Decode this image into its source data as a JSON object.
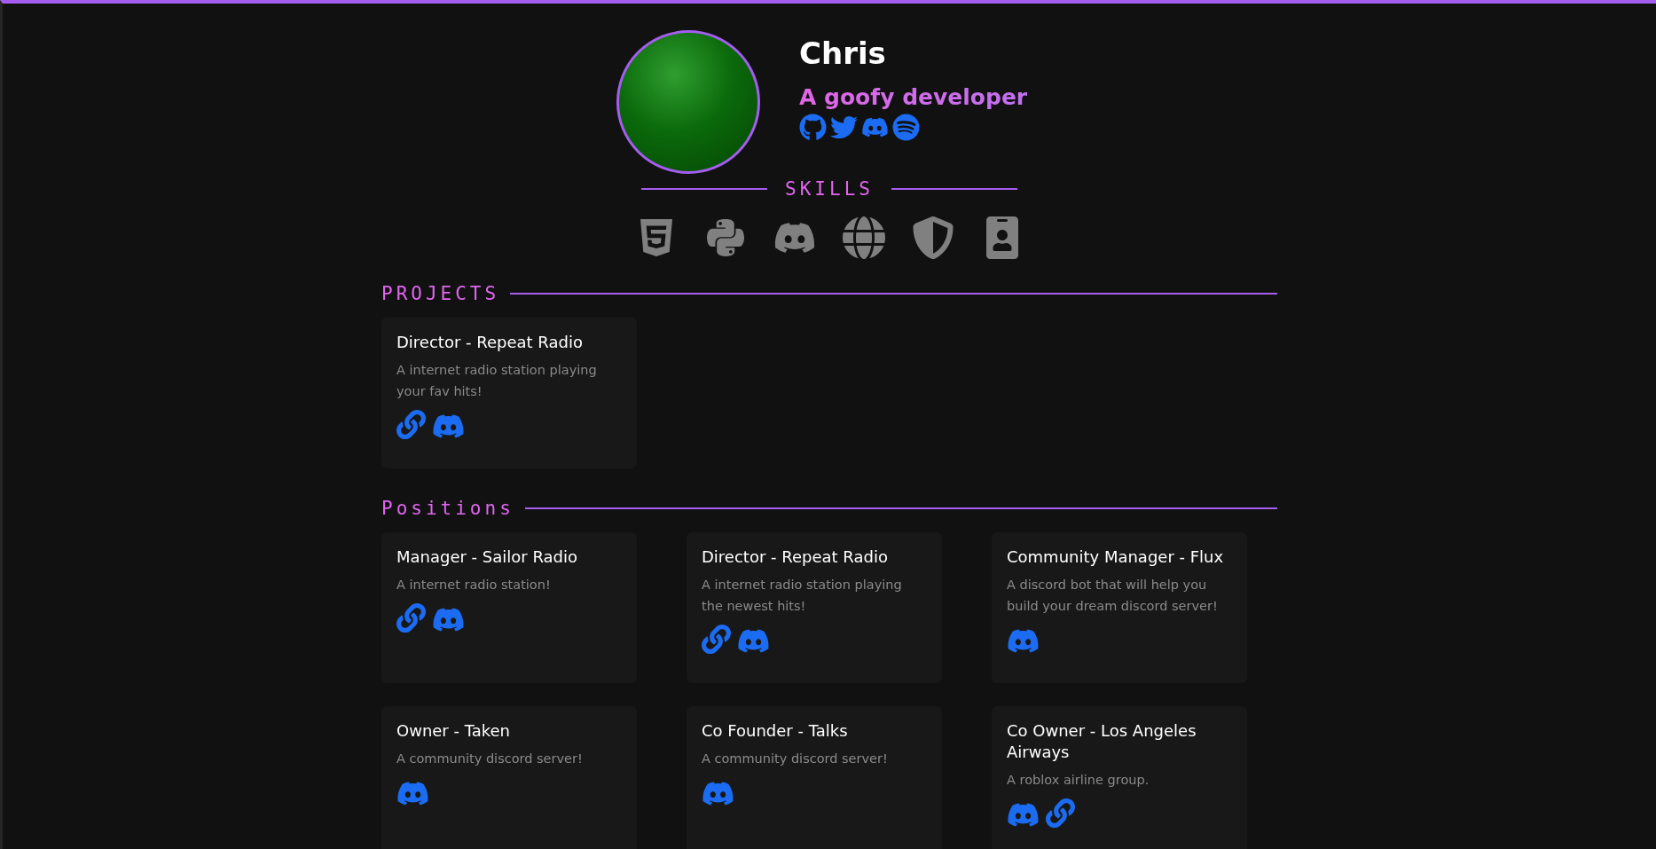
{
  "profile": {
    "name": "Chris",
    "tagline": "A goofy developer",
    "socials": [
      {
        "kind": "github"
      },
      {
        "kind": "twitter"
      },
      {
        "kind": "discord"
      },
      {
        "kind": "spotify"
      }
    ]
  },
  "skills": {
    "title": "SKILLS",
    "items": [
      {
        "kind": "html"
      },
      {
        "kind": "python"
      },
      {
        "kind": "discord"
      },
      {
        "kind": "web"
      },
      {
        "kind": "security"
      },
      {
        "kind": "badge"
      }
    ]
  },
  "projects": {
    "title": "PROJECTS",
    "cards": [
      {
        "title": "Director - Repeat Radio",
        "description": "A internet radio station playing your fav hits!",
        "links": [
          {
            "kind": "website"
          },
          {
            "kind": "discord"
          }
        ]
      }
    ]
  },
  "positions": {
    "title": "Positions",
    "cards": [
      {
        "title": "Manager - Sailor Radio",
        "description": "A internet radio station!",
        "links": [
          {
            "kind": "website"
          },
          {
            "kind": "discord"
          }
        ]
      },
      {
        "title": "Director - Repeat Radio",
        "description": "A internet radio station playing the newest hits!",
        "links": [
          {
            "kind": "website"
          },
          {
            "kind": "discord"
          }
        ]
      },
      {
        "title": "Community Manager - Flux",
        "description": "A discord bot that will help you build your dream discord server!",
        "links": [
          {
            "kind": "discord"
          }
        ]
      },
      {
        "title": "Owner - Taken",
        "description": "A community discord server!",
        "links": [
          {
            "kind": "discord"
          }
        ]
      },
      {
        "title": "Co Founder - Talks",
        "description": "A community discord server!",
        "links": [
          {
            "kind": "discord"
          }
        ]
      },
      {
        "title": "Co Owner - Los Angeles Airways",
        "description": "A roblox airline group.",
        "links": [
          {
            "kind": "discord"
          },
          {
            "kind": "website"
          }
        ]
      }
    ]
  }
}
